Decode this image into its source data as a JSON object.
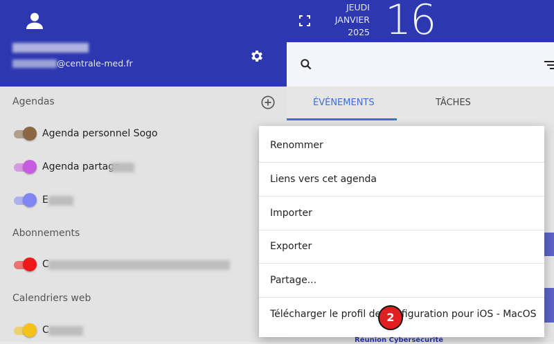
{
  "sidebar": {
    "email_suffix": "@centrale-med.fr",
    "sections": {
      "agendas": "Agendas",
      "abonnements": "Abonnements",
      "calendriers_web": "Calendriers web"
    },
    "calendars": [
      {
        "label": "Agenda personnel Sogo",
        "color": "#8b6642"
      },
      {
        "label": "Agenda partage",
        "color": "#c85ce0"
      },
      {
        "label": "E",
        "color": "#7f86f4"
      }
    ],
    "subscriptions": [
      {
        "label": "C",
        "color": "#f01818"
      }
    ],
    "web_calendars": [
      {
        "label": "C",
        "color": "#f4c21a"
      }
    ]
  },
  "header": {
    "weekday": "JEUDI",
    "month": "JANVIER",
    "year": "2025",
    "day": "16"
  },
  "tabs": {
    "events": "ÉVÉNEMENTS",
    "tasks": "TÂCHES"
  },
  "context_menu": {
    "items": [
      "Renommer",
      "Liens vers cet agenda",
      "Importer",
      "Exporter",
      "Partage...",
      "Télécharger le profil de configuration pour iOS - MacOS"
    ]
  },
  "annotation": {
    "step": "2"
  },
  "peek_text": "Réunion Cybersécurité",
  "colors": {
    "brand": "#2d37b0",
    "active_tab": "#3a6fd6"
  }
}
